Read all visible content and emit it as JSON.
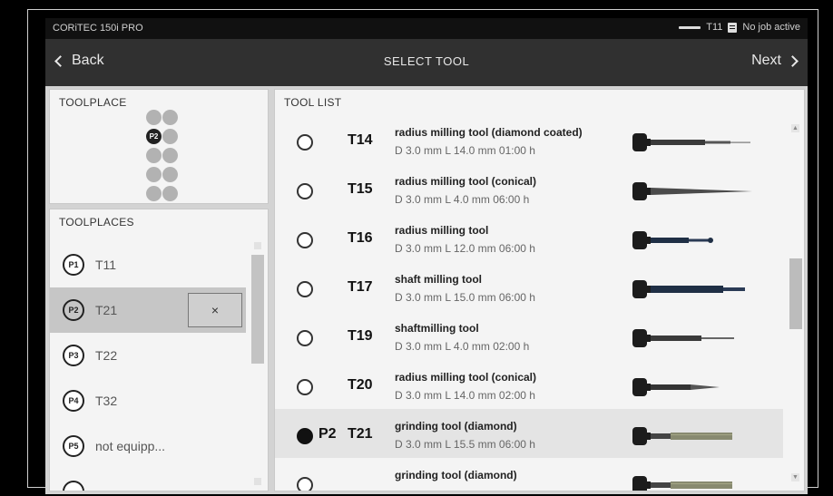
{
  "statusbar": {
    "app_name": "CORiTEC 150i PRO",
    "active_tool": "T11",
    "job_status": "No job active"
  },
  "navbar": {
    "back_label": "Back",
    "title": "SELECT TOOL",
    "next_label": "Next"
  },
  "toolplace": {
    "title": "TOOLPLACE",
    "active_slot": "P2"
  },
  "toolplaces": {
    "title": "TOOLPLACES",
    "clear_label": "×",
    "items": [
      {
        "place": "P1",
        "tool": "T11"
      },
      {
        "place": "P2",
        "tool": "T21"
      },
      {
        "place": "P3",
        "tool": "T22"
      },
      {
        "place": "P4",
        "tool": "T32"
      },
      {
        "place": "P5",
        "tool": "not equipp..."
      }
    ]
  },
  "toollist": {
    "title": "TOOL LIST",
    "items": [
      {
        "place": "",
        "code": "T14",
        "name": "radius milling tool (diamond coated)",
        "dims": "D 3.0 mm L 14.0 mm 01:00 h",
        "shape": "drill"
      },
      {
        "place": "",
        "code": "T15",
        "name": "radius milling tool (conical)",
        "dims": "D 3.0 mm L 4.0 mm 06:00 h",
        "shape": "cone"
      },
      {
        "place": "",
        "code": "T16",
        "name": "radius milling tool",
        "dims": "D 3.0 mm L 12.0 mm 06:00 h",
        "shape": "short-ball"
      },
      {
        "place": "",
        "code": "T17",
        "name": "shaft milling tool",
        "dims": "D 3.0 mm L 15.0 mm 06:00 h",
        "shape": "shaft"
      },
      {
        "place": "",
        "code": "T19",
        "name": "shaftmilling tool",
        "dims": "D 3.0 mm L 4.0 mm 02:00 h",
        "shape": "thin"
      },
      {
        "place": "",
        "code": "T20",
        "name": "radius milling tool (conical)",
        "dims": "D 3.0 mm L 14.0 mm 02:00 h",
        "shape": "taper"
      },
      {
        "place": "P2",
        "code": "T21",
        "name": "grinding tool (diamond)",
        "dims": "D 3.0 mm L 15.5 mm 06:00 h",
        "shape": "grinder"
      },
      {
        "place": "",
        "code": "",
        "name": "grinding tool (diamond)",
        "dims": "",
        "shape": "grinder"
      }
    ]
  }
}
